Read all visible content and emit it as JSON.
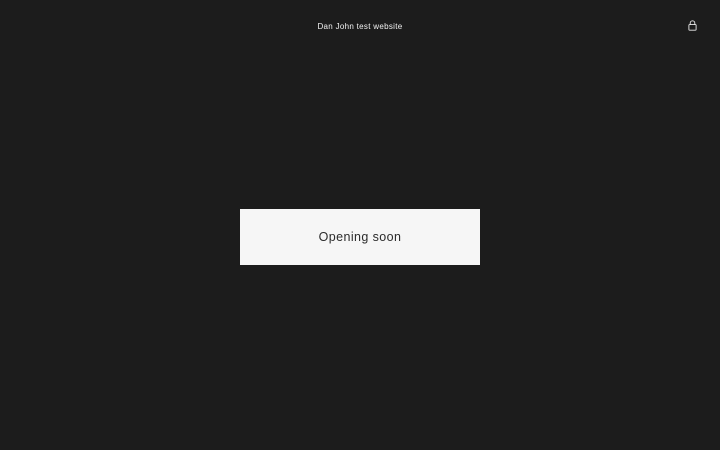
{
  "header": {
    "site_title": "Dan John test website",
    "login_icon": "lock-icon"
  },
  "main": {
    "notice_text": "Opening soon"
  },
  "colors": {
    "background": "#1c1c1c",
    "card": "#f6f6f6",
    "header_text": "#f2f2f2",
    "card_text": "#2b2b2b"
  }
}
